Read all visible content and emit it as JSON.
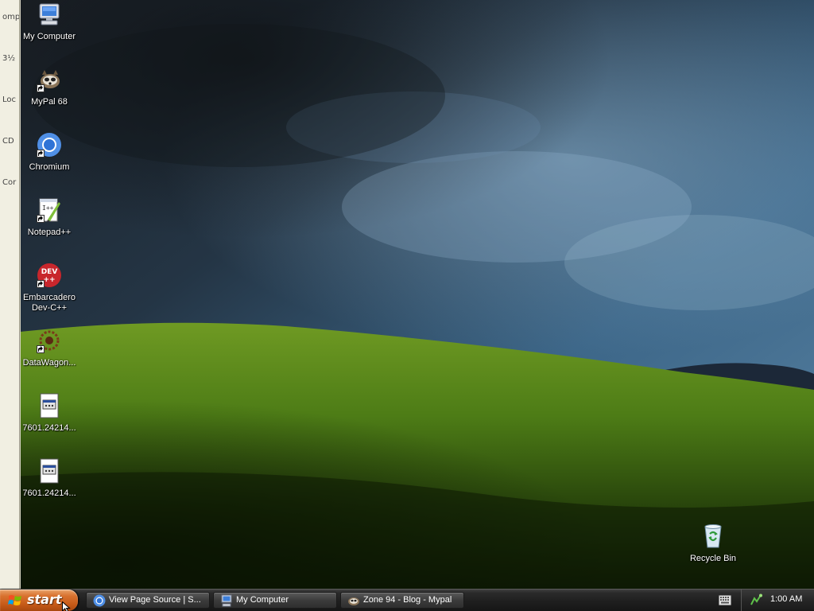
{
  "window_sidebar": {
    "texts": [
      "omp",
      "3½",
      "Loc",
      "CD",
      "Cor"
    ]
  },
  "desktop_icons": [
    {
      "label": "My Computer",
      "icon": "my-computer-icon"
    },
    {
      "label": "MyPal 68",
      "icon": "mypal-icon"
    },
    {
      "label": "Chromium",
      "icon": "chromium-icon"
    },
    {
      "label": "Notepad++",
      "icon": "notepad-plus-plus-icon"
    },
    {
      "label": "Embarcadero Dev-C++",
      "icon": "dev-cpp-icon"
    },
    {
      "label": "DataWagon...",
      "icon": "datawagon-icon"
    },
    {
      "label": "7601.24214...",
      "icon": "document-icon"
    },
    {
      "label": "7601.24214...",
      "icon": "document-icon"
    },
    {
      "label": "Recycle Bin",
      "icon": "recycle-bin-icon"
    }
  ],
  "taskbar": {
    "start_label": "start",
    "tasks": [
      {
        "label": "View Page Source | S...",
        "icon": "chromium-icon"
      },
      {
        "label": "My Computer",
        "icon": "my-computer-icon"
      },
      {
        "label": "Zone 94 - Blog - Mypal",
        "icon": "mypal-icon"
      }
    ],
    "clock": "1:00 AM"
  },
  "colors": {
    "taskbar": "#1f1f1f",
    "start_button": "#c65a18",
    "sky": "#2f4d68",
    "grass": "#3f6d14"
  }
}
